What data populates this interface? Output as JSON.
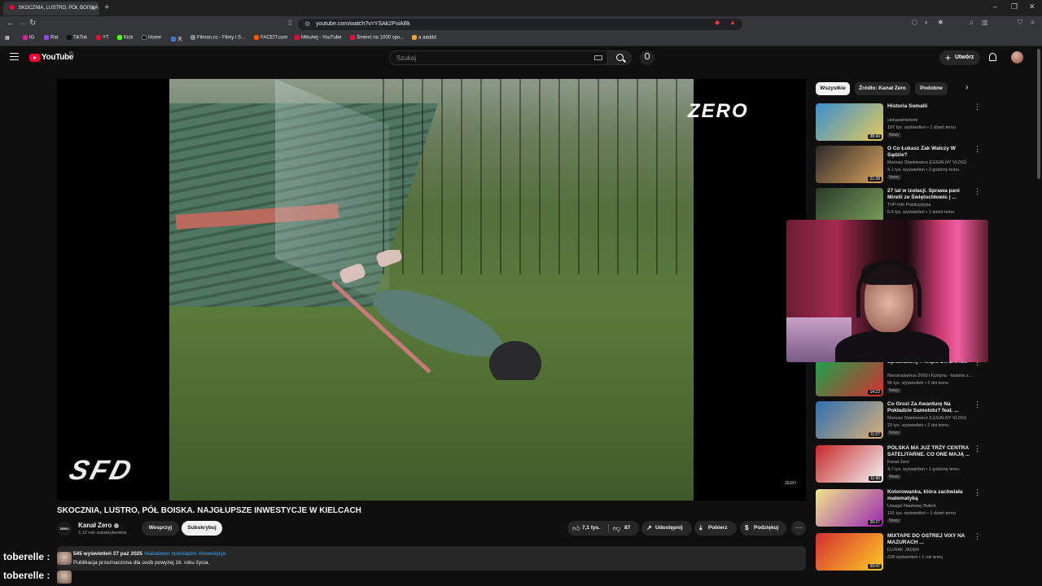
{
  "browser": {
    "tab_title": "SKOCZNIA, LUSTRO, PÓŁ BOISKA",
    "url": "youtube.com/watch?v=YSAk2PviABk",
    "bookmarks": [
      "IG",
      "Rat",
      "TikTok",
      "YT",
      "Kick",
      "Home",
      "天",
      "Filman.cc - Filmy i S...",
      "FACEIT.com",
      "Mikuhej - YouTube",
      "Śmierć na 1000 spo...",
      "a aaddd"
    ],
    "window_controls": [
      "–",
      "❐",
      "✕"
    ]
  },
  "header": {
    "logo_text": "YouTube",
    "region": "PL",
    "search_placeholder": "Szukaj",
    "create_label": "Utwórz"
  },
  "player": {
    "overlay_brand": "ZERO",
    "corner_logo": "SFD",
    "small_brand": "ZERO"
  },
  "video": {
    "title": "SKOCZNIA, LUSTRO, PÓŁ BOISKA. NAJGŁUPSZE INWESTYCJE W KIELCACH",
    "channel_name": "Kanał Zero",
    "channel_avatar_text": "ZERO",
    "subscribers": "2,12 mln subskrybentów",
    "join_label": "Wesprzyj",
    "subscribe_label": "Subskrybuj",
    "likes": "7,1 tys.",
    "dislikes": "87",
    "share_label": "Udostępnij",
    "download_label": "Pobierz",
    "thanks_label": "Podziękuj",
    "description_stats": "545 wyświetleń  27 paź 2025 ",
    "description_tags": "#kanalzero #pieniądze #inwestycje",
    "description_text": "Publikacja przeznaczona dla osób powyżej 16. roku życia."
  },
  "chat": [
    {
      "user": "toberelle :"
    },
    {
      "user": "toberelle :"
    }
  ],
  "chips": [
    "Wszystkie",
    "Źródło: Kanał Zero",
    "Podobne"
  ],
  "recommendations": [
    {
      "title": "Historia Somalii",
      "channel": "ciekawehistorie",
      "views": "197 tys. wyświetleń • 1 dzień temu",
      "badge": "Nowy",
      "duration": "38:40",
      "colors": [
        "#3a8fd0",
        "#e2c95a"
      ]
    },
    {
      "title": "O Co Łukasz Żak Walczy W Sądzie?",
      "channel": "Mariusz Stankiewicz (LEGALNY VLOG)",
      "views": "4,1 tys. wyświetleń • 2 godziny temu",
      "badge": "Nowy",
      "duration": "21:28",
      "colors": [
        "#2b2b2b",
        "#d9a25b"
      ]
    },
    {
      "title": "27 lat w izolacji. Sprawa pani Mirelli ze Świętochłowic | ...",
      "channel": "TVP Info Publicystyka",
      "views": "6,4 tys. wyświetleń • 1 dzień temu",
      "badge": "",
      "duration": "",
      "colors": [
        "#2a3a2a",
        "#7aa05a"
      ]
    },
    {
      "title": "Sprawdzony Przepis Dr. Dre N...",
      "channel": "Neostradamus 2000 i Kurtyna - historie z...",
      "views": "56 tys. wyświetleń • 2 dni temu",
      "badge": "Nowy",
      "duration": "14:22",
      "colors": [
        "#17a64b",
        "#d32f2f"
      ]
    },
    {
      "title": "Co Grozi Za Awanturę Na Pokładzie Samolotu? feat. ...",
      "channel": "Mariusz Stankiewicz (LEGALNY VLOG)",
      "views": "23 tys. wyświetleń • 2 dni temu",
      "badge": "Nowy",
      "duration": "11:07",
      "colors": [
        "#2e6fb0",
        "#d9b07a"
      ]
    },
    {
      "title": "POLSKA MA JUŻ TRZY CENTRA SATELITARNE. CO ONE MAJĄ ...",
      "channel": "Kanał Zero",
      "views": "4,7 tys. wyświetleń • 1 godzinę temu",
      "badge": "Nowy",
      "duration": "11:40",
      "colors": [
        "#c62828",
        "#f5f5f5"
      ]
    },
    {
      "title": "Kolorowanka, która zachwiała matematyką",
      "channel": "Uwaga! Naukowy Bełkot",
      "views": "191 tys. wyświetleń • 1 dzień temu",
      "badge": "Nowy",
      "duration": "26:27",
      "colors": [
        "#f0e68c",
        "#9c27b0"
      ]
    },
    {
      "title": "MIXTAPE DO OSTREJ VIXY NA MAZURACH ...",
      "channel": "DJ RAK JADER",
      "views": "228 wyświetleń • 1 rok temu",
      "badge": "",
      "duration": "39:47",
      "colors": [
        "#d32f2f",
        "#ffca28"
      ]
    }
  ]
}
